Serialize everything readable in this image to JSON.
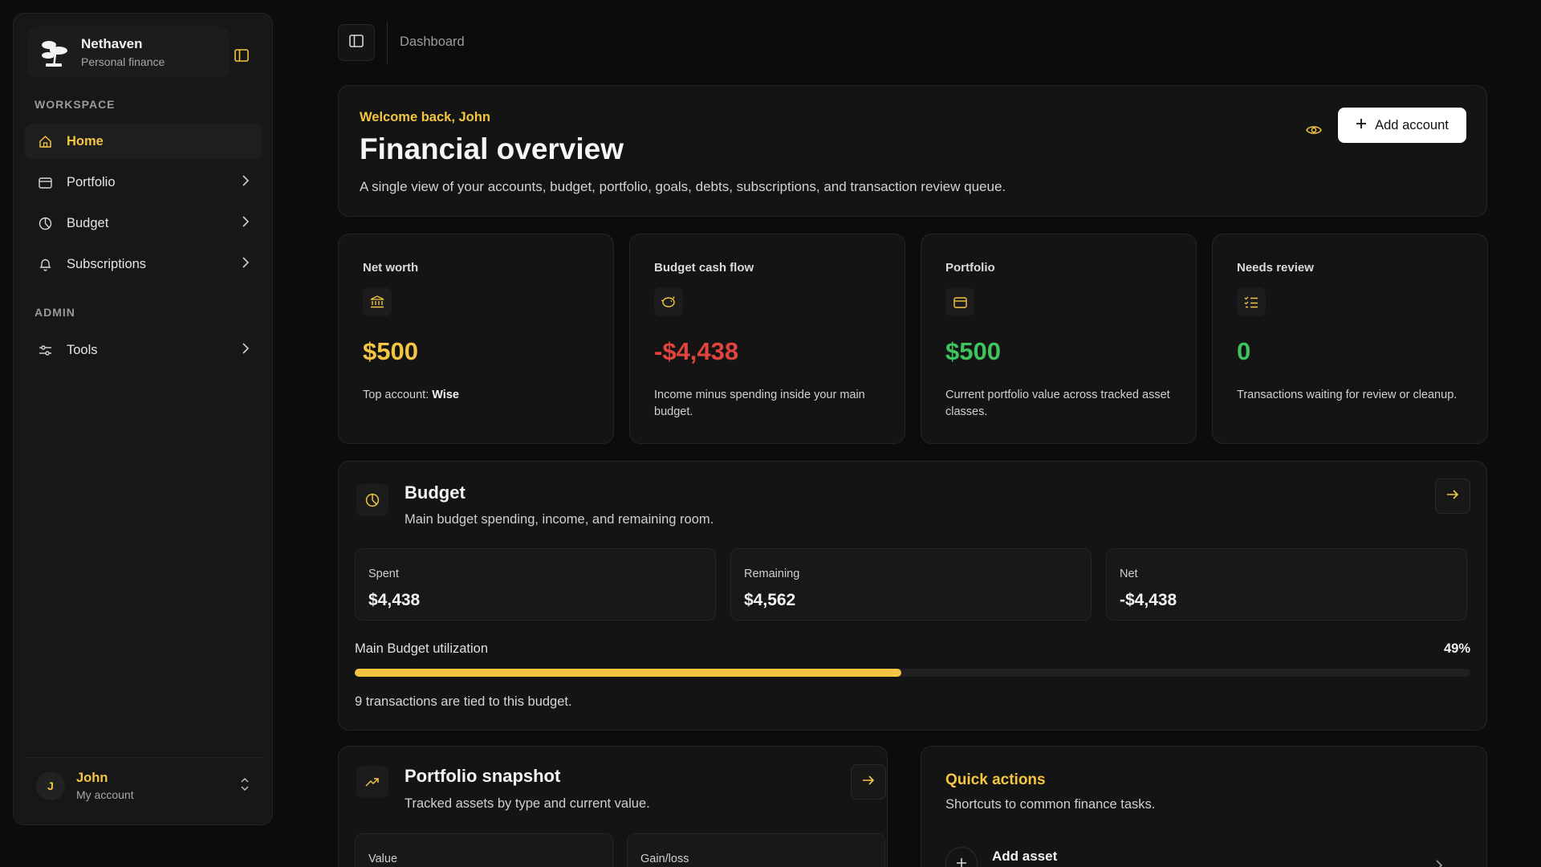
{
  "brand": {
    "name": "Nethaven",
    "subtitle": "Personal finance"
  },
  "sidebar": {
    "workspace_label": "WORKSPACE",
    "admin_label": "ADMIN",
    "items": [
      {
        "label": "Home",
        "icon": "home-icon",
        "active": true
      },
      {
        "label": "Portfolio",
        "icon": "wallet-icon"
      },
      {
        "label": "Budget",
        "icon": "pie-chart-icon"
      },
      {
        "label": "Subscriptions",
        "icon": "bell-icon"
      },
      {
        "label": "Tools",
        "icon": "sliders-icon"
      }
    ],
    "user": {
      "initial": "J",
      "name": "John",
      "subtitle": "My account"
    }
  },
  "topbar": {
    "breadcrumb": "Dashboard"
  },
  "hero": {
    "welcome": "Welcome back, John",
    "title": "Financial overview",
    "description": "A single view of your accounts, budget, portfolio, goals, debts, subscriptions, and transaction review queue.",
    "add_account_label": "Add account"
  },
  "stats": [
    {
      "label": "Net worth",
      "icon": "bank-icon",
      "value": "$500",
      "desc_prefix": "Top account: ",
      "desc_strong": "Wise",
      "color": "#f4c542"
    },
    {
      "label": "Budget cash flow",
      "icon": "piggy-bank-icon",
      "value": "-$4,438",
      "desc": "Income minus spending inside your main budget.",
      "color": "#e0443c"
    },
    {
      "label": "Portfolio",
      "icon": "wallet-icon",
      "value": "$500",
      "desc": "Current portfolio value across tracked asset classes.",
      "color": "#3ec45d"
    },
    {
      "label": "Needs review",
      "icon": "checklist-icon",
      "value": "0",
      "desc": "Transactions waiting for review or cleanup.",
      "color": "#3ec45d"
    }
  ],
  "budget": {
    "title": "Budget",
    "description": "Main budget spending, income, and remaining room.",
    "spent_label": "Spent",
    "spent_value": "$4,438",
    "remaining_label": "Remaining",
    "remaining_value": "$4,562",
    "net_label": "Net",
    "net_value": "-$4,438",
    "utilization_label": "Main Budget utilization",
    "utilization_pct": "49%",
    "utilization_fraction": 0.49,
    "footer": "9 transactions are tied to this budget."
  },
  "portfolio_snapshot": {
    "title": "Portfolio snapshot",
    "description": "Tracked assets by type and current value.",
    "value_label": "Value",
    "gain_label": "Gain/loss"
  },
  "quick_actions": {
    "title": "Quick actions",
    "description": "Shortcuts to common finance tasks.",
    "first_item": "Add asset"
  },
  "colors": {
    "accent": "#f4c542",
    "negative": "#e0443c",
    "positive": "#3ec45d"
  }
}
